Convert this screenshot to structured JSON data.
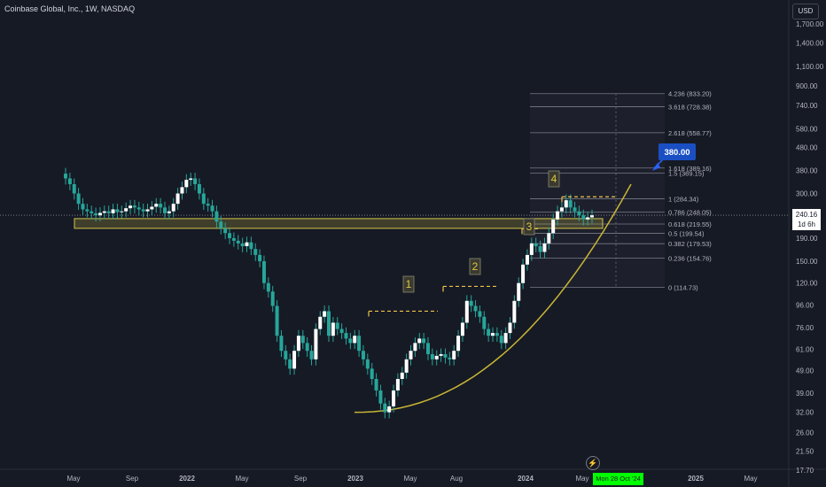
{
  "title": "Coinbase Global, Inc., 1W, NASDAQ",
  "currency_button": "USD",
  "current_price": "240.16",
  "countdown": "1d 6h",
  "date_badge": "Mon 28 Oct '24",
  "colors": {
    "background": "#161a25",
    "up": "#26a69a",
    "up_body": "#ffffff",
    "down": "#26a69a",
    "support_zone": "#d4c44a",
    "trend_curve": "#c9b535",
    "dashed": "#f0c24a",
    "fib_lines": "#787b86",
    "target_label": "#1a4fc4",
    "date_badge": "#00ff00"
  },
  "chart_data": {
    "type": "candlestick",
    "y_scale": "log",
    "y_ticks": [
      "1,700.00",
      "1,400.00",
      "1,100.00",
      "900.00",
      "740.00",
      "580.00",
      "480.00",
      "380.00",
      "300.00",
      "240.00",
      "190.00",
      "150.00",
      "120.00",
      "96.00",
      "76.00",
      "61.00",
      "49.00",
      "39.00",
      "32.00",
      "26.00",
      "21.50",
      "17.70"
    ],
    "x_ticks": [
      "May",
      "Sep",
      "2022",
      "May",
      "Sep",
      "2023",
      "May",
      "Aug",
      "2024",
      "May",
      "2025",
      "May"
    ],
    "series_close": [
      350,
      330,
      300,
      270,
      255,
      250,
      245,
      240,
      246,
      250,
      245,
      255,
      248,
      250,
      258,
      265,
      260,
      255,
      250,
      255,
      262,
      270,
      260,
      245,
      250,
      270,
      300,
      320,
      345,
      350,
      330,
      300,
      270,
      265,
      250,
      225,
      210,
      200,
      190,
      185,
      180,
      175,
      182,
      170,
      160,
      150,
      120,
      110,
      95,
      70,
      60,
      55,
      50,
      60,
      70,
      65,
      60,
      55,
      75,
      85,
      90,
      70,
      80,
      75,
      72,
      68,
      65,
      70,
      60,
      55,
      50,
      45,
      40,
      35,
      32,
      34,
      40,
      45,
      48,
      55,
      60,
      65,
      68,
      65,
      58,
      55,
      57,
      58,
      56,
      55,
      60,
      70,
      80,
      100,
      95,
      90,
      85,
      75,
      70,
      72,
      70,
      65,
      72,
      80,
      100,
      120,
      145,
      160,
      180,
      175,
      165,
      180,
      200,
      230,
      250,
      260,
      280,
      260,
      250,
      240,
      230,
      235,
      240
    ],
    "fibonacci": [
      {
        "level": "4.236 (833.20)",
        "value": 833.2
      },
      {
        "level": "3.618 (728.38)",
        "value": 728.38
      },
      {
        "level": "2.618 (558.77)",
        "value": 558.77
      },
      {
        "level": "1.618 (389.16)",
        "value": 389.16
      },
      {
        "level": "1.5 (369.15)",
        "value": 369.15
      },
      {
        "level": "1 (284.34)",
        "value": 284.34
      },
      {
        "level": "0.786 (248.05)",
        "value": 248.05
      },
      {
        "level": "0.618 (219.55)",
        "value": 219.55
      },
      {
        "level": "0.5 (199.54)",
        "value": 199.54
      },
      {
        "level": "0.382 (179.53)",
        "value": 179.53
      },
      {
        "level": "0.236 (154.76)",
        "value": 154.76
      },
      {
        "level": "0 (114.73)",
        "value": 114.73
      }
    ],
    "annotations": {
      "target": "380.00",
      "waves": [
        "1",
        "2",
        "3",
        "4"
      ]
    }
  }
}
